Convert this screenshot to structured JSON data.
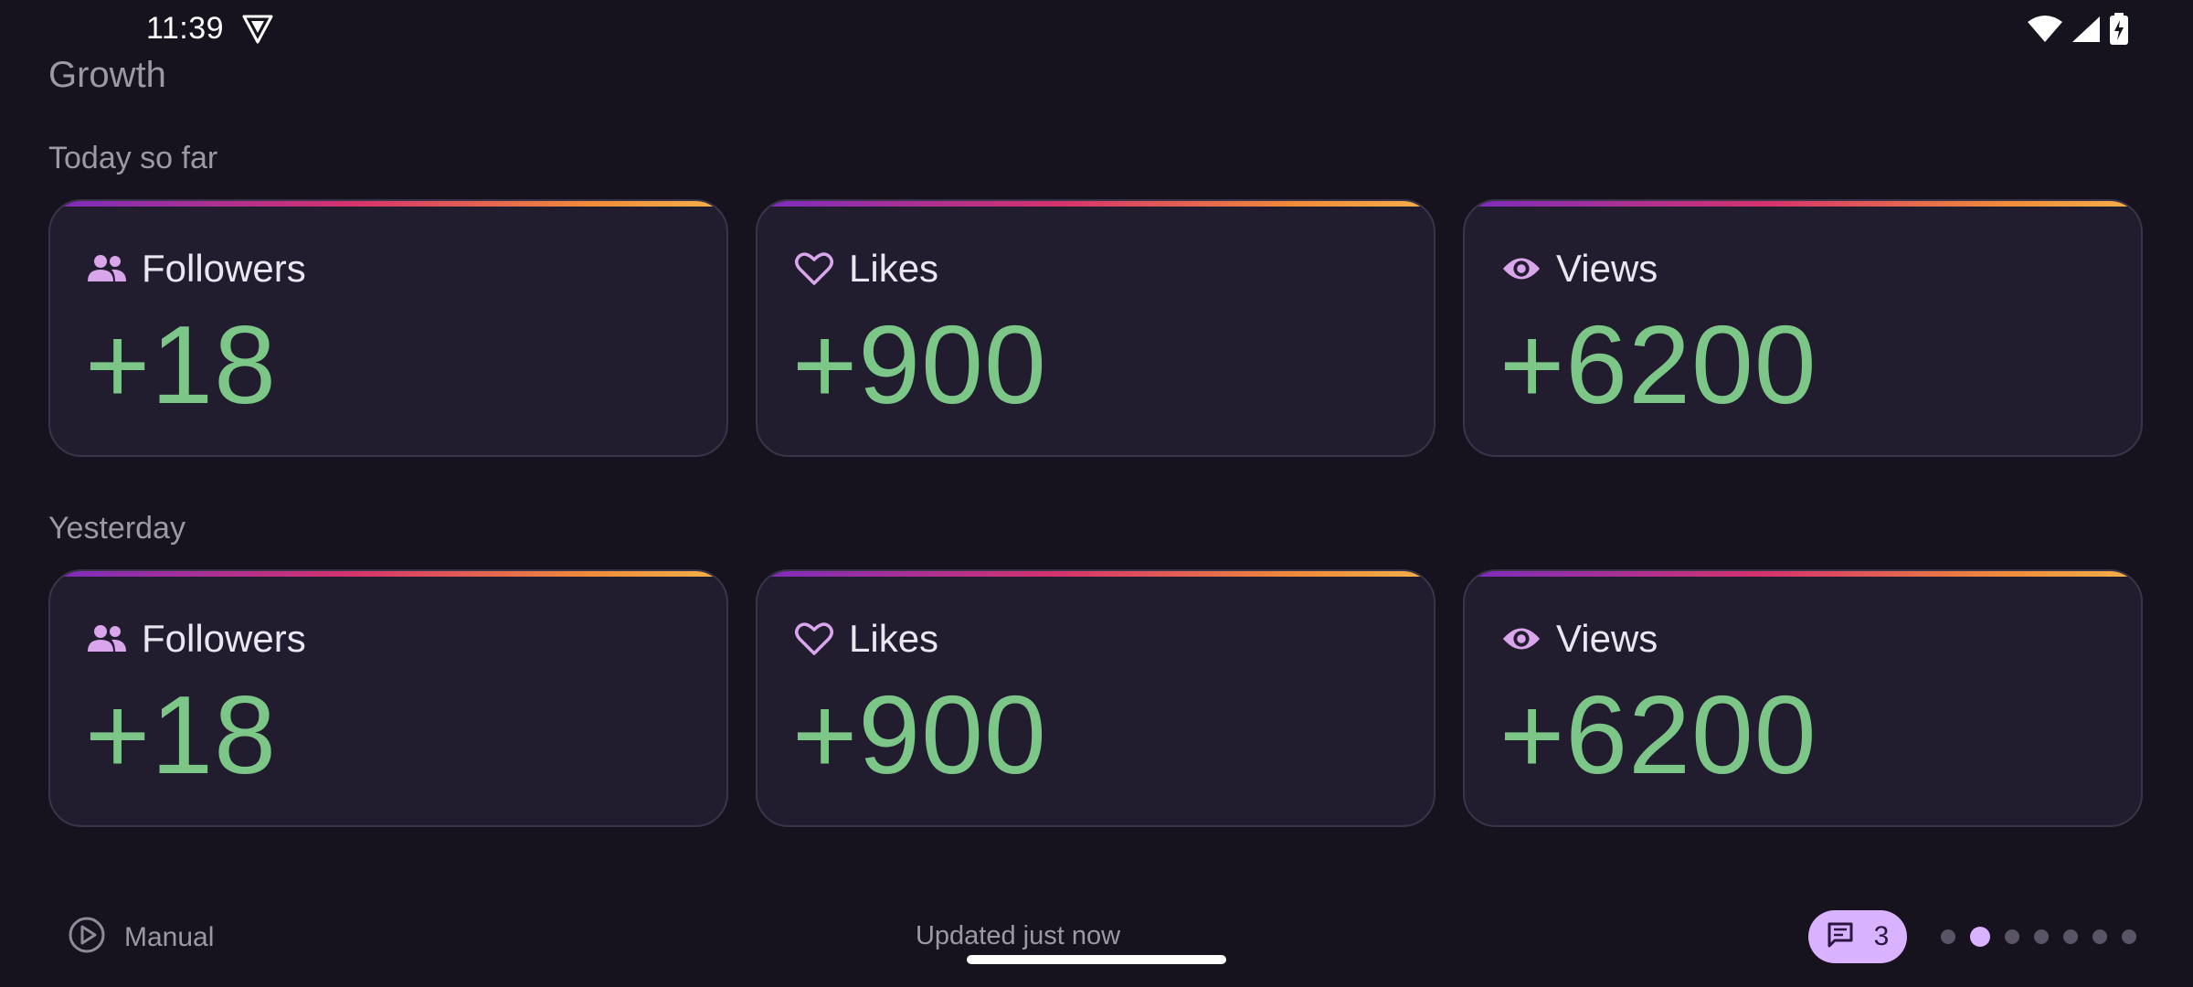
{
  "status_bar": {
    "time": "11:39",
    "icons": [
      "vpn-shield-icon",
      "wifi-icon",
      "cell-signal-icon",
      "battery-charging-icon"
    ]
  },
  "app": {
    "title": "Growth"
  },
  "sections": [
    {
      "label": "Today so far",
      "cards": [
        {
          "icon": "people-icon",
          "title": "Followers",
          "value": "+18"
        },
        {
          "icon": "heart-icon",
          "title": "Likes",
          "value": "+900"
        },
        {
          "icon": "eye-icon",
          "title": "Views",
          "value": "+6200"
        }
      ]
    },
    {
      "label": "Yesterday",
      "cards": [
        {
          "icon": "people-icon",
          "title": "Followers",
          "value": "+18"
        },
        {
          "icon": "heart-icon",
          "title": "Likes",
          "value": "+900"
        },
        {
          "icon": "eye-icon",
          "title": "Views",
          "value": "+6200"
        }
      ]
    }
  ],
  "footer": {
    "manual_label": "Manual",
    "updated_text": "Updated just now",
    "chat_count": "3",
    "pager": {
      "total": 7,
      "active_index": 1
    }
  },
  "colors": {
    "background": "#16131e",
    "card": "#211d2e",
    "value_green": "#7cc687",
    "accent_purple": "#d9b3ff"
  }
}
